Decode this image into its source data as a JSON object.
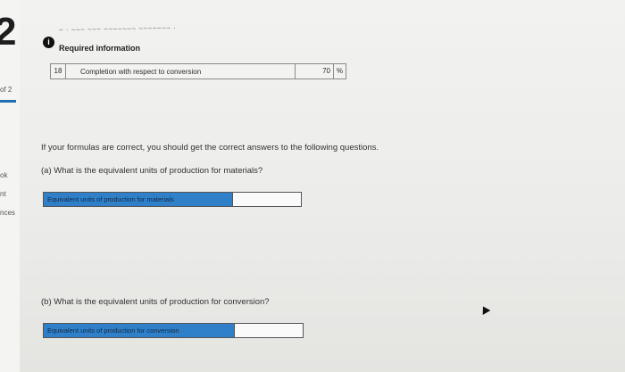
{
  "sidebar": {
    "big_number": "2",
    "page_indicator": "of 2",
    "labels": [
      "ok",
      "nt",
      "nces"
    ]
  },
  "header": {
    "blurred_text": "~ · ~~~ ~~~ ~~~~~~~ ~~~~~~~ ·",
    "info_icon": "i",
    "required_info": "Required information"
  },
  "data_row": {
    "number": "18",
    "label": "Completion with respect to conversion",
    "value": "70",
    "unit": "%"
  },
  "instruction": "If your formulas are correct, you should get the correct answers to the following questions.",
  "questions": [
    {
      "text": "(a) What is the equivalent units of production for materials?",
      "answer_label": "Equivalent units of production for materials",
      "answer_value": ""
    },
    {
      "text": "(b) What is the equivalent units of production for conversion?",
      "answer_label": "Equivalent units of production for conversion",
      "answer_value": ""
    }
  ],
  "colors": {
    "answer_label_bg": "#2f80c8",
    "progress_accent": "#1f6fb2"
  }
}
